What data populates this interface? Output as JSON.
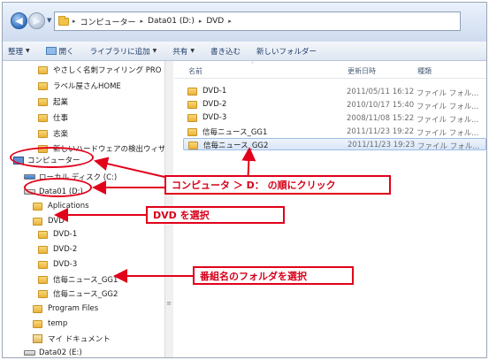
{
  "address": {
    "crumbs": [
      "コンピューター",
      "Data01 (D:)",
      "DVD"
    ]
  },
  "toolbar": {
    "organize": "整理",
    "open": "開く",
    "library": "ライブラリに追加",
    "share": "共有",
    "write": "書き込む",
    "new_folder": "新しいフォルダー"
  },
  "nav": {
    "items": [
      {
        "label": "やさしく名刺ファイリング PRO Ⅰ"
      },
      {
        "label": "ラベル屋さんHOME"
      },
      {
        "label": "起業"
      },
      {
        "label": "仕事"
      },
      {
        "label": "志楽"
      },
      {
        "label": "新しいハードウェアの検出ウィザ"
      },
      {
        "label": "コンピューター"
      },
      {
        "label": "ローカル ディスク (C:)"
      },
      {
        "label": "Data01 (D:)"
      },
      {
        "label": "Aplications"
      },
      {
        "label": "DVD"
      },
      {
        "label": "DVD-1"
      },
      {
        "label": "DVD-2"
      },
      {
        "label": "DVD-3"
      },
      {
        "label": "信毎ニュース_GG1"
      },
      {
        "label": "信毎ニュース_GG2"
      },
      {
        "label": "Program Files"
      },
      {
        "label": "temp"
      },
      {
        "label": "マイ ドキュメント"
      },
      {
        "label": "Data02 (E:)"
      }
    ]
  },
  "columns": {
    "name": "名前",
    "date": "更新日時",
    "type": "種類"
  },
  "files": [
    {
      "name": "DVD-1",
      "date": "2011/05/11 16:12",
      "type": "ファイル フォル..."
    },
    {
      "name": "DVD-2",
      "date": "2010/10/17 15:40",
      "type": "ファイル フォル..."
    },
    {
      "name": "DVD-3",
      "date": "2008/11/08 15:22",
      "type": "ファイル フォル..."
    },
    {
      "name": "信毎ニュース_GG1",
      "date": "2011/11/23 19:22",
      "type": "ファイル フォル..."
    },
    {
      "name": "信毎ニュース_GG2",
      "date": "2011/11/23 19:23",
      "type": "ファイル フォル..."
    }
  ],
  "annotations": {
    "computer_to_d": "コンピュータ ＞ D： の順にクリック",
    "select_dvd": "DVD を選択",
    "select_program": "番組名のフォルダを選択"
  },
  "colors": {
    "annotation": "#e2001a",
    "folder": "#f1c34b",
    "selection": "#d7e6f9"
  }
}
